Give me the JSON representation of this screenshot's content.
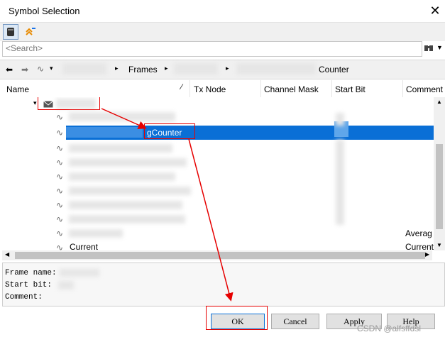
{
  "window": {
    "title": "Symbol Selection",
    "close_glyph": "✕"
  },
  "toolbar": {
    "buttons": [
      "database-icon",
      "collapse-up-icon"
    ]
  },
  "search": {
    "placeholder": "<Search>"
  },
  "breadcrumb": {
    "frames_label": "Frames",
    "signal_suffix": "Counter"
  },
  "columns": [
    "Name",
    "Tx Node",
    "Channel Mask",
    "Start Bit",
    "Comment"
  ],
  "tree": {
    "selected_signal_suffix": "gCounter",
    "avg_label": "Averag",
    "current_label": "Current",
    "current_comment": "Current"
  },
  "info_panel": {
    "frame_name_label": "Frame name:",
    "start_bit_label": "Start bit:",
    "comment_label": "Comment:"
  },
  "buttons": {
    "ok": "OK",
    "cancel": "Cancel",
    "apply": "Apply",
    "help": "Help"
  },
  "watermark": "CSDN @alfsffdsl",
  "colors": {
    "selection": "#0a6fd6",
    "annotation": "#e60000"
  }
}
